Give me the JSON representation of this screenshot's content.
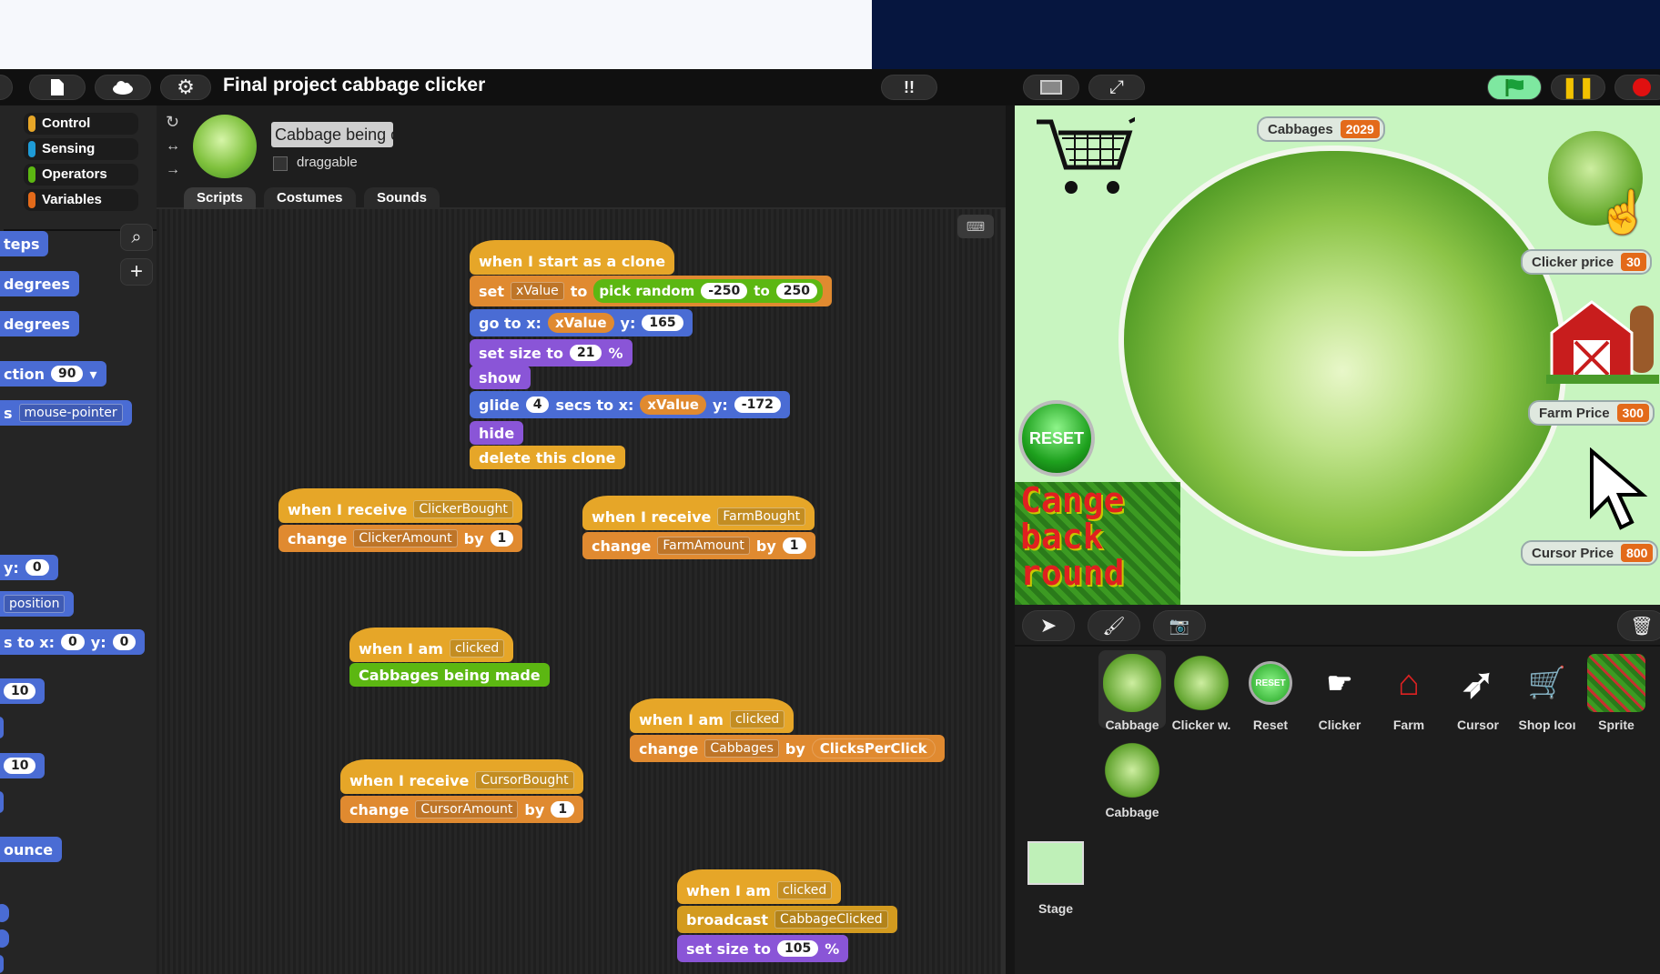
{
  "app": {
    "title": "Final project cabbage clicker"
  },
  "palette": {
    "categories": [
      {
        "label": "Control",
        "color": "#e6a628"
      },
      {
        "label": "Sensing",
        "color": "#1e9bd6"
      },
      {
        "label": "Operators",
        "color": "#5cb712"
      },
      {
        "label": "Variables",
        "color": "#e36a1a"
      }
    ],
    "blocks": {
      "steps": "teps",
      "deg1": "degrees",
      "deg2": "degrees",
      "direction": "ction",
      "direction_val": "90",
      "towards": "s",
      "towards_val": "mouse-pointer",
      "y": "y:",
      "y_val": "0",
      "position": "position",
      "glide": "s to x:",
      "glide_x": "0",
      "glide_y_lbl": "y:",
      "glide_y": "0",
      "change10a": "10",
      "change10b": "10",
      "bounce": "ounce"
    }
  },
  "sprite": {
    "name": "Cabbage being clicl",
    "draggable": "draggable"
  },
  "tabs": [
    "Scripts",
    "Costumes",
    "Sounds"
  ],
  "scripts": {
    "s1": {
      "hat": "when I start as a clone",
      "set": "set",
      "var": "xValue",
      "to": "to",
      "pick": "pick random",
      "a": "-250",
      "to2": "to",
      "b": "250",
      "goto": "go to x:",
      "xv": "xValue",
      "y": "y:",
      "yv": "165",
      "size": "set size to",
      "sv": "21",
      "pct": "%",
      "show": "show",
      "glide": "glide",
      "gs": "4",
      "secs": "secs to x:",
      "gx": "xValue",
      "gy": "y:",
      "gyv": "-172",
      "hide": "hide",
      "del": "delete this clone"
    },
    "s2": {
      "hat": "when I receive",
      "msg": "ClickerBought",
      "change": "change",
      "var": "ClickerAmount",
      "by": "by",
      "val": "1"
    },
    "s3": {
      "hat": "when I receive",
      "msg": "FarmBought",
      "change": "change",
      "var": "FarmAmount",
      "by": "by",
      "val": "1"
    },
    "s4": {
      "hat": "when I am",
      "ev": "clicked",
      "say": "Cabbages being made"
    },
    "s5": {
      "hat": "when I am",
      "ev": "clicked",
      "change": "change",
      "var": "Cabbages",
      "by": "by",
      "rep": "ClicksPerClick"
    },
    "s6": {
      "hat": "when I receive",
      "msg": "CursorBought",
      "change": "change",
      "var": "CursorAmount",
      "by": "by",
      "val": "1"
    },
    "s7": {
      "hat": "when I am",
      "ev": "clicked",
      "bc": "broadcast",
      "msg": "CabbageClicked",
      "size": "set size to",
      "sv": "105",
      "pct": "%"
    }
  },
  "stage": {
    "watchers": [
      {
        "label": "Cabbages",
        "value": "2029"
      },
      {
        "label": "Clicker price",
        "value": "30"
      },
      {
        "label": "Farm Price",
        "value": "300"
      },
      {
        "label": "Cursor Price",
        "value": "800"
      }
    ],
    "reset": "RESET",
    "bg_text": [
      "Cange",
      "back",
      "round"
    ]
  },
  "corral": {
    "sprites": [
      {
        "name": "Cabbage"
      },
      {
        "name": "Clicker w."
      },
      {
        "name": "Reset"
      },
      {
        "name": "Clicker"
      },
      {
        "name": "Farm"
      },
      {
        "name": "Cursor"
      },
      {
        "name": "Shop Icoı"
      },
      {
        "name": "Sprite"
      },
      {
        "name": "Cabbage"
      }
    ],
    "stage": "Stage",
    "reset_thumb": "RESET"
  }
}
